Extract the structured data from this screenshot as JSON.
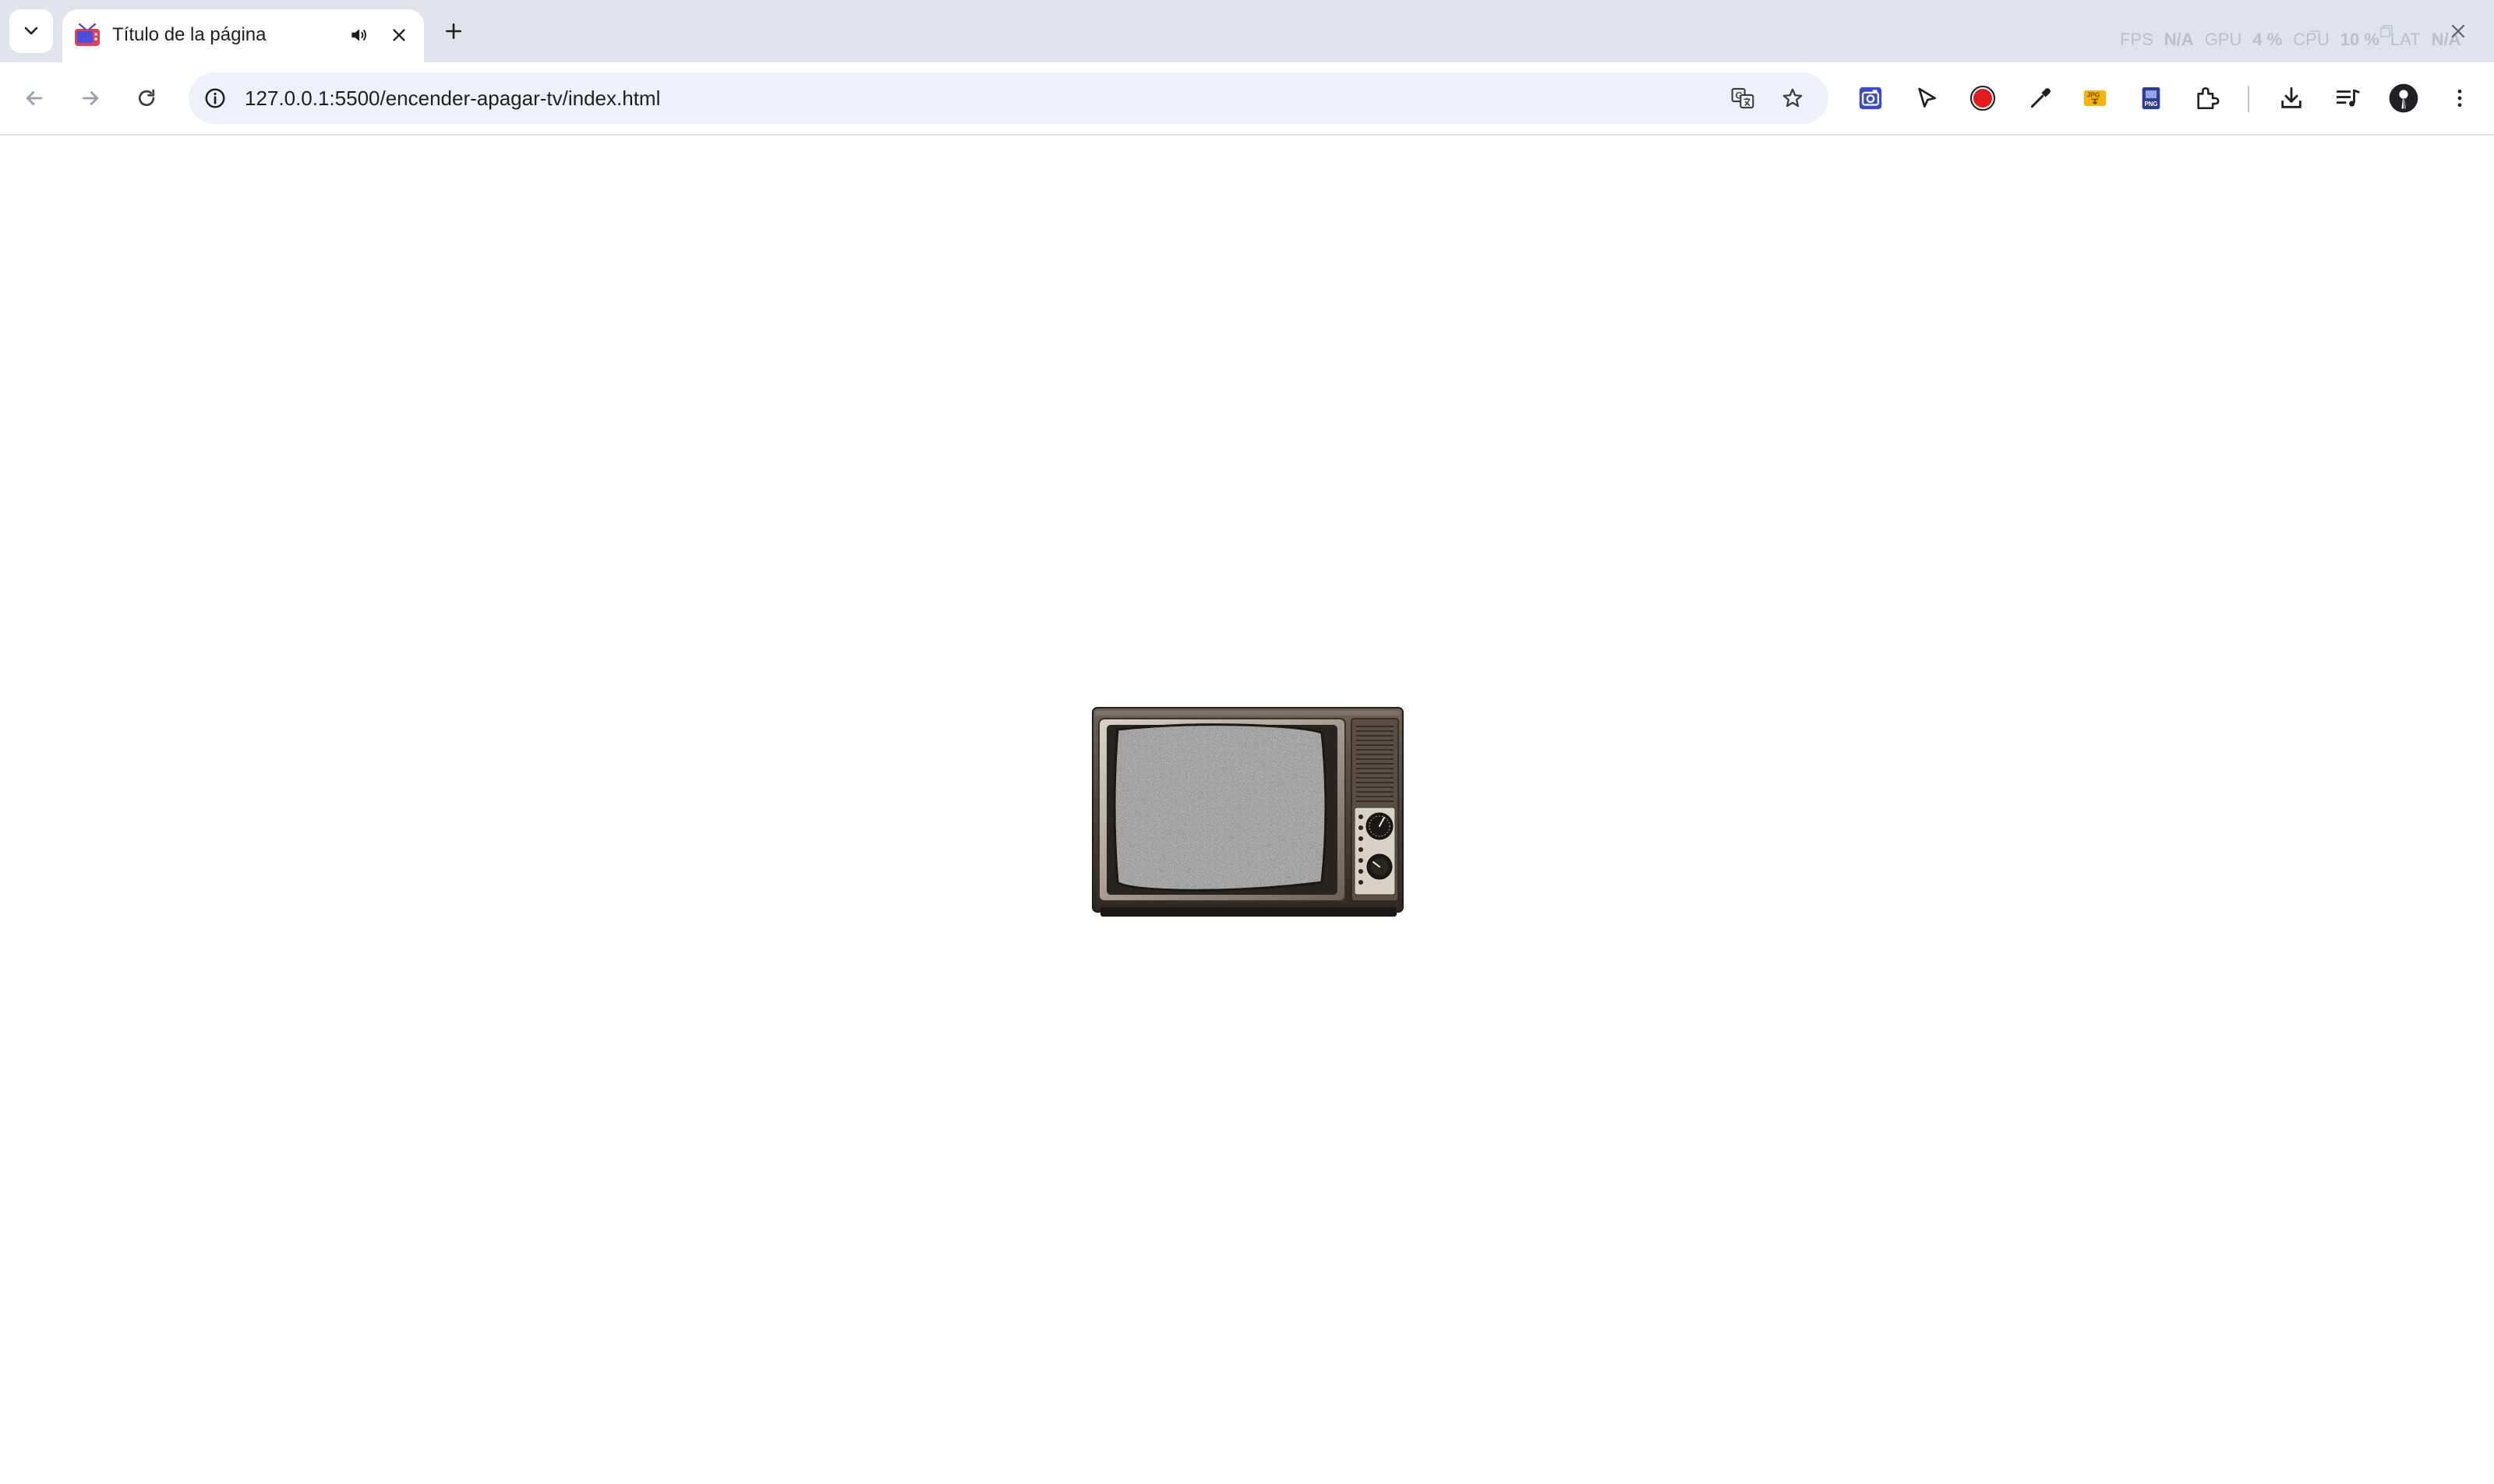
{
  "tab": {
    "title": "Título de la página"
  },
  "address_bar": {
    "url": "127.0.0.1:5500/encender-apagar-tv/index.html"
  },
  "perf_overlay": {
    "fps_label": "FPS",
    "fps_value": "N/A",
    "gpu_label": "GPU",
    "gpu_value": "4 %",
    "cpu_label": "CPU",
    "cpu_value": "10 %",
    "lat_label": "LAT",
    "lat_value": "N/A"
  },
  "colors": {
    "tabstrip_bg": "#dfe3ea",
    "omnibox_bg": "#edf2fa",
    "record_red": "#e31b1b",
    "extension_blue": "#3a4bd0"
  },
  "icons": {
    "tab_search": "chevron-down-icon",
    "favicon": "favicon",
    "audio": "speaker-icon",
    "close": "close-icon",
    "new_tab": "plus-icon",
    "back": "arrow-left-icon",
    "forward": "arrow-right-icon",
    "reload": "reload-icon",
    "site_info": "info-icon",
    "translate": "translate-icon",
    "bookmark": "star-icon",
    "extensions": [
      "camera-extension-icon",
      "cursor-extension-icon",
      "record-icon",
      "eyedropper-icon",
      "jpg-extension-icon",
      "png-extension-icon",
      "puzzle-icon"
    ],
    "download": "download-icon",
    "media": "media-playlist-icon",
    "profile": "profile-icon",
    "menu": "kebab-menu-icon"
  },
  "content": {
    "image": "retro-tv-with-static"
  }
}
